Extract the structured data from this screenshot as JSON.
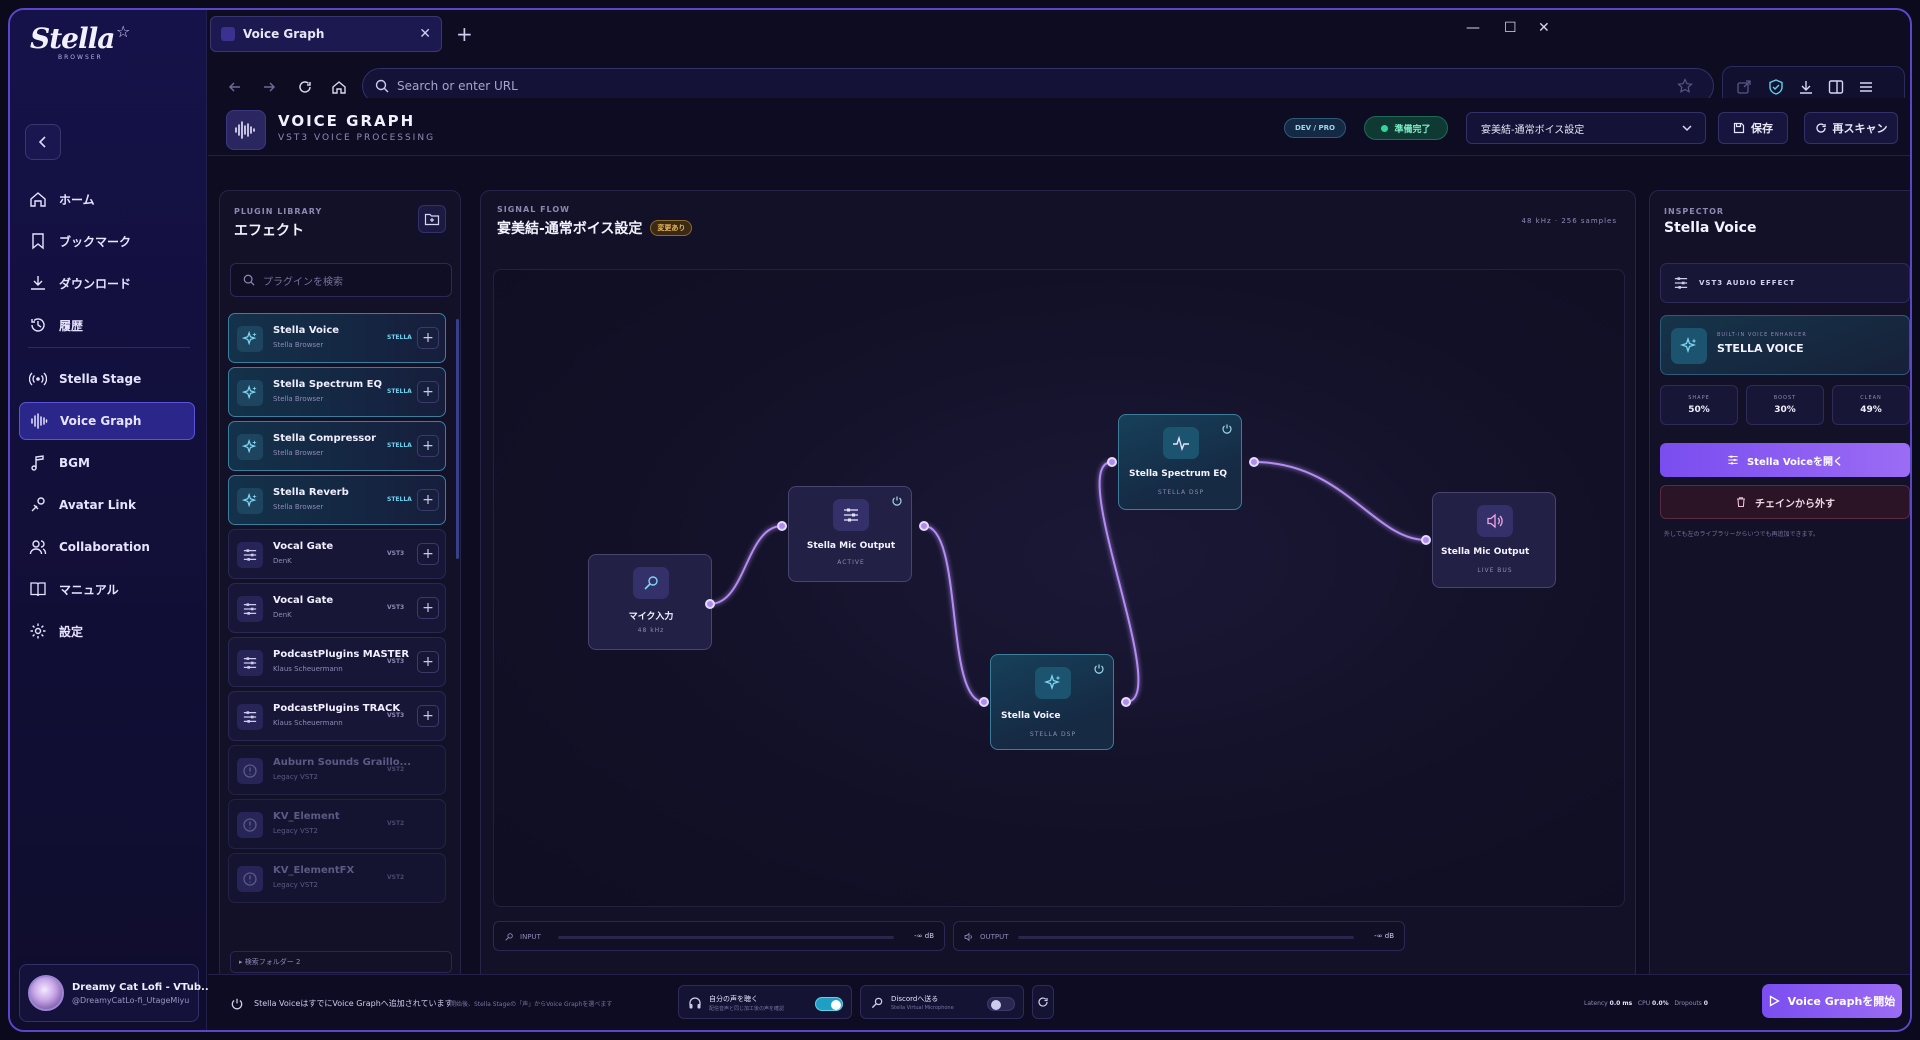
{
  "app": {
    "logo_text": "Stella",
    "logo_sub": "BROWSER"
  },
  "browser": {
    "tab_title": "Voice Graph",
    "url_placeholder": "Search or enter URL"
  },
  "sidebar": {
    "items": [
      {
        "label": "ホーム",
        "icon": "home-icon"
      },
      {
        "label": "ブックマーク",
        "icon": "bookmark-icon"
      },
      {
        "label": "ダウンロード",
        "icon": "download-icon"
      },
      {
        "label": "履歴",
        "icon": "history-icon"
      },
      {
        "label": "Stella Stage",
        "icon": "broadcast-icon"
      },
      {
        "label": "Voice Graph",
        "icon": "waveform-icon",
        "active": true
      },
      {
        "label": "BGM",
        "icon": "music-note-icon"
      },
      {
        "label": "Avatar Link",
        "icon": "avatar-link-icon"
      },
      {
        "label": "Collaboration",
        "icon": "users-icon"
      },
      {
        "label": "マニュアル",
        "icon": "book-icon"
      },
      {
        "label": "設定",
        "icon": "gear-icon"
      }
    ],
    "user": {
      "name": "Dreamy Cat Lofi - VTub...",
      "handle": "@DreamyCatLo-fi_UtageMiyu"
    }
  },
  "header": {
    "title": "VOICE GRAPH",
    "subtitle": "VST3 VOICE PROCESSING",
    "mode_badge": "DEV / PRO",
    "status": "準備完了",
    "preset": "宴美結-通常ボイス設定",
    "save_label": "保存",
    "rescan_label": "再スキャン"
  },
  "library": {
    "section": "PLUGIN LIBRARY",
    "title": "エフェクト",
    "search_placeholder": "プラグインを検索",
    "plugins": [
      {
        "name": "Stella Voice",
        "vendor": "Stella Browser",
        "tag": "STELLA",
        "kind": "stella"
      },
      {
        "name": "Stella Spectrum EQ",
        "vendor": "Stella Browser",
        "tag": "STELLA",
        "kind": "stella"
      },
      {
        "name": "Stella Compressor",
        "vendor": "Stella Browser",
        "tag": "STELLA",
        "kind": "stella"
      },
      {
        "name": "Stella Reverb",
        "vendor": "Stella Browser",
        "tag": "STELLA",
        "kind": "stella"
      },
      {
        "name": "Vocal Gate",
        "vendor": "DenK",
        "tag": "VST3",
        "kind": "vst3"
      },
      {
        "name": "Vocal Gate",
        "vendor": "DenK",
        "tag": "VST3",
        "kind": "vst3"
      },
      {
        "name": "PodcastPlugins MASTER",
        "vendor": "Klaus Scheuermann",
        "tag": "VST3",
        "kind": "vst3"
      },
      {
        "name": "PodcastPlugins TRACK",
        "vendor": "Klaus Scheuermann",
        "tag": "VST3",
        "kind": "vst3"
      },
      {
        "name": "Auburn Sounds Graillo...",
        "vendor": "Legacy VST2",
        "tag": "VST2",
        "kind": "legacy"
      },
      {
        "name": "KV_Element",
        "vendor": "Legacy VST2",
        "tag": "VST2",
        "kind": "legacy"
      },
      {
        "name": "KV_ElementFX",
        "vendor": "Legacy VST2",
        "tag": "VST2",
        "kind": "legacy"
      }
    ],
    "folder_label": "▸ 検索フォルダー 2"
  },
  "flow": {
    "section": "SIGNAL FLOW",
    "title": "宴美結-通常ボイス設定",
    "changed_badge": "変更あり",
    "rate": "48 kHz · 256 samples",
    "nodes": {
      "mic_input": {
        "name": "マイク入力",
        "sub": "48 kHz"
      },
      "mic_output": {
        "name": "Stella Mic Output",
        "sub": "ACTIVE"
      },
      "voice": {
        "name": "Stella Voice",
        "sub": "STELLA DSP"
      },
      "spectrum": {
        "name": "Stella Spectrum EQ",
        "sub": "STELLA DSP"
      },
      "live_out": {
        "name": "Stella Mic Output",
        "sub": "LIVE BUS"
      }
    },
    "input_label": "INPUT",
    "input_db": "-∞ dB",
    "output_label": "OUTPUT",
    "output_db": "-∞ dB"
  },
  "inspector": {
    "section": "INSPECTOR",
    "title": "Stella Voice",
    "type_label": "VST3 AUDIO EFFECT",
    "card_kicker": "BUILT-IN VOICE ENHANCER",
    "card_title": "STELLA VOICE",
    "stats": [
      {
        "k": "SHAPE",
        "v": "50%"
      },
      {
        "k": "BOOST",
        "v": "30%"
      },
      {
        "k": "CLEAN",
        "v": "49%"
      }
    ],
    "open_label": "Stella Voiceを開く",
    "remove_label": "チェインから外す",
    "hint": "外しても左のライブラリーからいつでも再追加できます。"
  },
  "footer": {
    "message": "Stella VoiceはすでにVoice Graphへ追加されています",
    "hint": "開始後、Stella Stageの「声」からVoice Graphを選べます",
    "monitor_title": "自分の声を聴く",
    "monitor_sub": "配信音声と同じ加工後の声を確認",
    "discord_title": "Discordへ送る",
    "discord_sub": "Stella Virtual Microphone",
    "latency_label": "Latency",
    "latency": "0.0 ms",
    "cpu_label": "CPU",
    "cpu": "0.0%",
    "dropouts_label": "Dropouts",
    "dropouts": "0",
    "start_label": "Voice Graphを開始"
  },
  "colors": {
    "accent": "#8b5cf6",
    "stella": "#3e7d9a",
    "ready": "#34d399"
  }
}
